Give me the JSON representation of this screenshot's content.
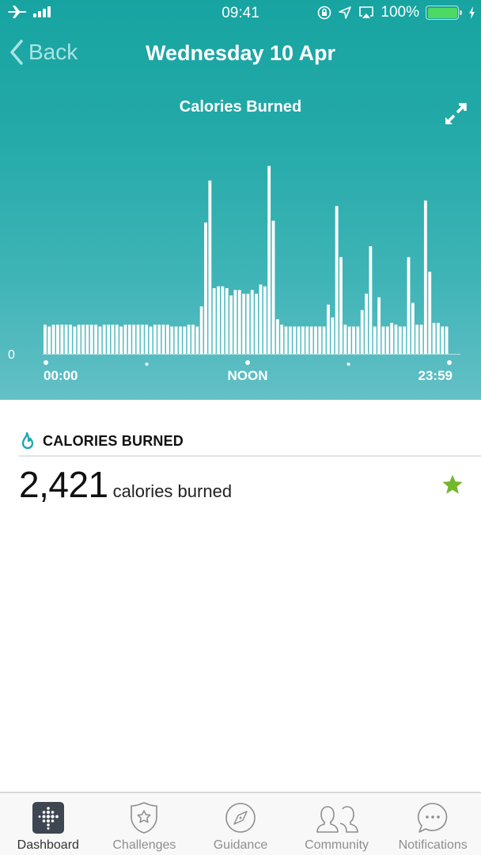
{
  "status_bar": {
    "time": "09:41",
    "battery": "100%",
    "icons": [
      "airplane-icon",
      "signal-icon",
      "rotation-lock-icon",
      "location-icon",
      "airplay-icon",
      "battery-icon",
      "charging-icon"
    ]
  },
  "nav": {
    "back_label": "Back",
    "title": "Wednesday 10 Apr"
  },
  "chart_data": {
    "type": "bar",
    "title": "Calories Burned",
    "xlabel": "",
    "ylabel": "",
    "y_tick_labels": [
      "0"
    ],
    "x_tick_labels": [
      "00:00",
      "NOON",
      "23:59"
    ],
    "interval_minutes": 15,
    "ylim": [
      0,
      105
    ],
    "values": [
      16,
      15,
      16,
      16,
      16,
      16,
      16,
      15,
      16,
      16,
      16,
      16,
      16,
      15,
      16,
      16,
      16,
      16,
      15,
      16,
      16,
      16,
      16,
      16,
      16,
      15,
      16,
      16,
      16,
      16,
      15,
      15,
      15,
      15,
      16,
      16,
      15,
      26,
      72,
      95,
      36,
      37,
      37,
      36,
      32,
      35,
      35,
      33,
      33,
      35,
      33,
      38,
      37,
      103,
      73,
      19,
      16,
      15,
      15,
      15,
      15,
      15,
      15,
      15,
      15,
      15,
      15,
      27,
      20,
      81,
      53,
      16,
      15,
      15,
      15,
      24,
      33,
      59,
      15,
      31,
      15,
      15,
      17,
      16,
      15,
      15,
      53,
      28,
      16,
      16,
      84,
      45,
      17,
      17,
      15,
      15
    ],
    "grid": false,
    "legend": "none"
  },
  "summary": {
    "section_label": "CALORIES BURNED",
    "value": "2,421",
    "unit_label": "calories burned",
    "goal_met": true,
    "star_color": "#73b72b"
  },
  "tabs": [
    {
      "label": "Dashboard",
      "icon": "dashboard-icon",
      "active": true
    },
    {
      "label": "Challenges",
      "icon": "challenges-icon",
      "active": false
    },
    {
      "label": "Guidance",
      "icon": "compass-icon",
      "active": false
    },
    {
      "label": "Community",
      "icon": "community-icon",
      "active": false
    },
    {
      "label": "Notifications",
      "icon": "notifications-icon",
      "active": false
    }
  ],
  "colors": {
    "accent": "#17a4a1",
    "flame": "#1fa7b4"
  }
}
